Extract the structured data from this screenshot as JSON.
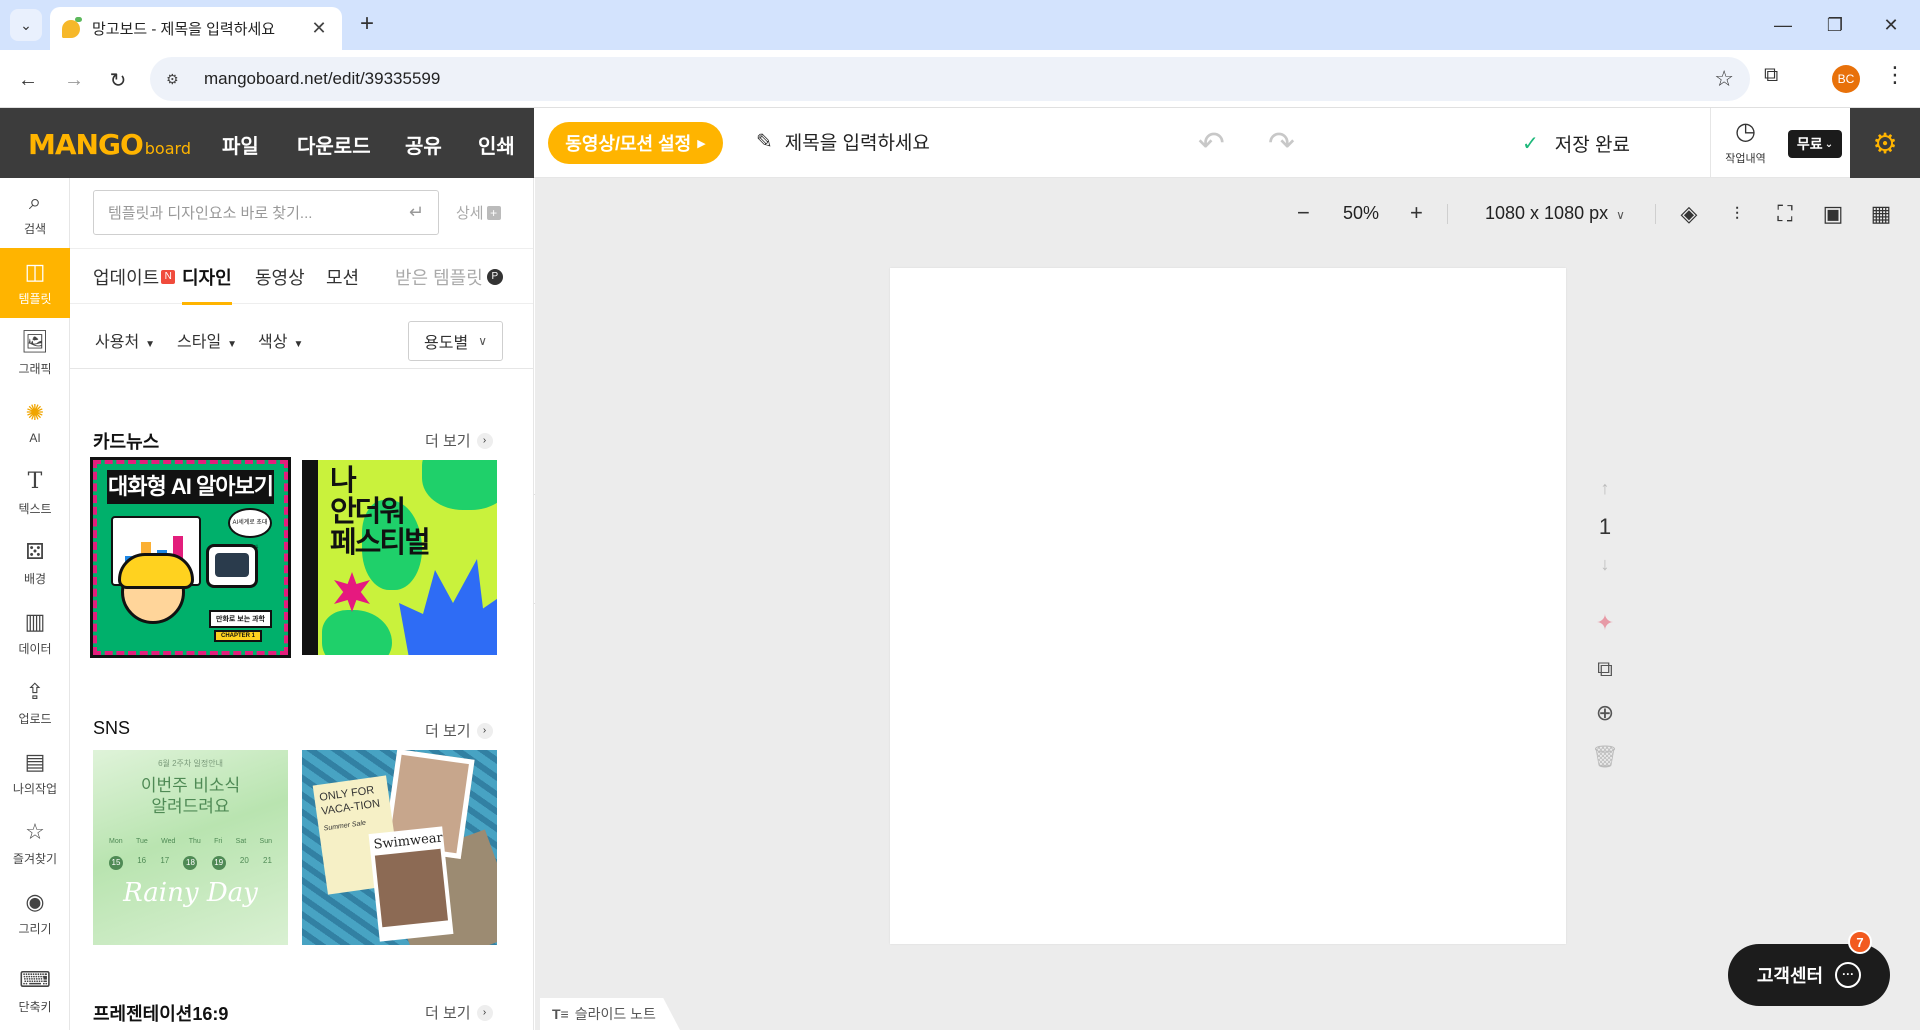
{
  "browser": {
    "tab_title": "망고보드 - 제목을 입력하세요",
    "url": "mangoboard.net/edit/39335599",
    "profile_initials": "BC"
  },
  "header": {
    "logo_main": "MANGO",
    "logo_sub": "board",
    "menu": [
      "파일",
      "다운로드",
      "공유",
      "인쇄"
    ],
    "motion_button": "동영상/모션 설정",
    "doc_title": "제목을 입력하세요",
    "save_status": "저장 완료",
    "history_label": "작업내역",
    "plan_label": "무료"
  },
  "rail": {
    "items": [
      {
        "label": "검색",
        "icon": "search-icon"
      },
      {
        "label": "템플릿",
        "icon": "template-icon"
      },
      {
        "label": "그래픽",
        "icon": "graphic-icon"
      },
      {
        "label": "AI",
        "icon": "ai-icon"
      },
      {
        "label": "텍스트",
        "icon": "text-icon"
      },
      {
        "label": "배경",
        "icon": "background-icon"
      },
      {
        "label": "데이터",
        "icon": "chart-icon"
      },
      {
        "label": "업로드",
        "icon": "upload-icon"
      },
      {
        "label": "나의작업",
        "icon": "my-work-icon"
      },
      {
        "label": "즐겨찾기",
        "icon": "star-icon"
      },
      {
        "label": "그리기",
        "icon": "draw-icon"
      },
      {
        "label": "단축키",
        "icon": "keyboard-icon"
      }
    ]
  },
  "panel": {
    "search_placeholder": "템플릿과 디자인요소 바로 찾기...",
    "detail_label": "상세",
    "tabs": [
      {
        "label": "업데이트",
        "badge": "N"
      },
      {
        "label": "디자인"
      },
      {
        "label": "동영상"
      },
      {
        "label": "모션"
      },
      {
        "label": "받은 템플릿",
        "badge": "P"
      }
    ],
    "filters": [
      "사용처",
      "스타일",
      "색상"
    ],
    "usage_select": "용도별",
    "more_label": "더 보기",
    "sections": [
      {
        "title": "카드뉴스"
      },
      {
        "title": "SNS"
      },
      {
        "title": "프레젠테이션16:9"
      }
    ],
    "thumbs": {
      "ai_title": "대화형 AI 알아보기",
      "ai_bubble": "AI세계로 초대합니다",
      "ai_tag1": "만화로 보는 과학",
      "ai_tag2": "CHAPTER 1",
      "fest_line1": "나",
      "fest_line2": "안더워",
      "fest_line3": "페스티벌",
      "rain_top": "6월 2주차 일정안내",
      "rain_h1": "이번주 비소식",
      "rain_h2": "알려드려요",
      "rain_days": [
        "Mon",
        "Tue",
        "Wed",
        "Thu",
        "Fri",
        "Sat",
        "Sun"
      ],
      "rain_nums": [
        "15",
        "16",
        "17",
        "18",
        "19",
        "20",
        "21"
      ],
      "rain_title": "Rainy Day",
      "swim_card": "ONLY FOR VACA-TION",
      "swim_sub": "Summer Sale",
      "swim_photo": "Swimwear"
    }
  },
  "canvas": {
    "zoom": "50%",
    "size": "1080 x 1080 px",
    "page_number": "1",
    "notes_label": "슬라이드 노트"
  },
  "support": {
    "label": "고객센터",
    "badge": "7"
  }
}
